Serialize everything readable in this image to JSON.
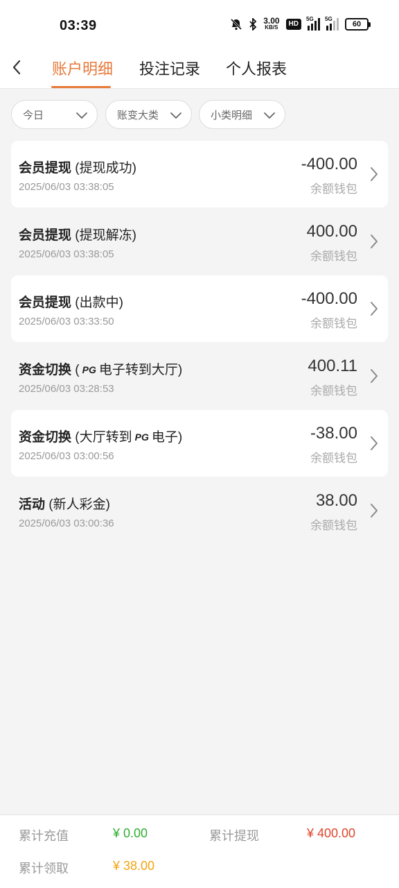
{
  "status_bar": {
    "time": "03:39",
    "speed_value": "3.00",
    "speed_unit": "KB/S",
    "hd": "HD",
    "sig1": "5G",
    "sig2": "5G",
    "battery": "60"
  },
  "nav": {
    "tabs": [
      "账户明细",
      "投注记录",
      "个人报表"
    ],
    "active_tab": 0
  },
  "filters": [
    "今日",
    "账变大类",
    "小类明细"
  ],
  "transactions": [
    {
      "category": "会员提现",
      "detail": "(提现成功)",
      "date": "2025/06/03 03:38:05",
      "amount": "-400.00",
      "wallet": "余额钱包",
      "bg": "white"
    },
    {
      "category": "会员提现",
      "detail": "(提现解冻)",
      "date": "2025/06/03 03:38:05",
      "amount": "400.00",
      "wallet": "余额钱包",
      "bg": "plain"
    },
    {
      "category": "会员提现",
      "detail": "(出款中)",
      "date": "2025/06/03 03:33:50",
      "amount": "-400.00",
      "wallet": "余额钱包",
      "bg": "white"
    },
    {
      "category": "资金切换",
      "detail_pre": "(",
      "detail_logo": "PG",
      "detail_post": "电子转到大厅)",
      "date": "2025/06/03 03:28:53",
      "amount": "400.11",
      "wallet": "余额钱包",
      "bg": "plain"
    },
    {
      "category": "资金切换",
      "detail_pre": "(大厅转到",
      "detail_logo": "PG",
      "detail_post": "电子)",
      "date": "2025/06/03 03:00:56",
      "amount": "-38.00",
      "wallet": "余额钱包",
      "bg": "white"
    },
    {
      "category": "活动",
      "detail": "(新人彩金)",
      "date": "2025/06/03 03:00:36",
      "amount": "38.00",
      "wallet": "余额钱包",
      "bg": "plain"
    }
  ],
  "summary": {
    "recharge_label": "累计充值",
    "recharge_value": "¥ 0.00",
    "withdraw_label": "累计提现",
    "withdraw_value": "¥ 400.00",
    "claim_label": "累计领取",
    "claim_value": "¥ 38.00"
  },
  "colors": {
    "accent": "#e8793a",
    "recharge": "#2fae2f",
    "withdraw": "#e0452c",
    "claim": "#f2a40f"
  }
}
